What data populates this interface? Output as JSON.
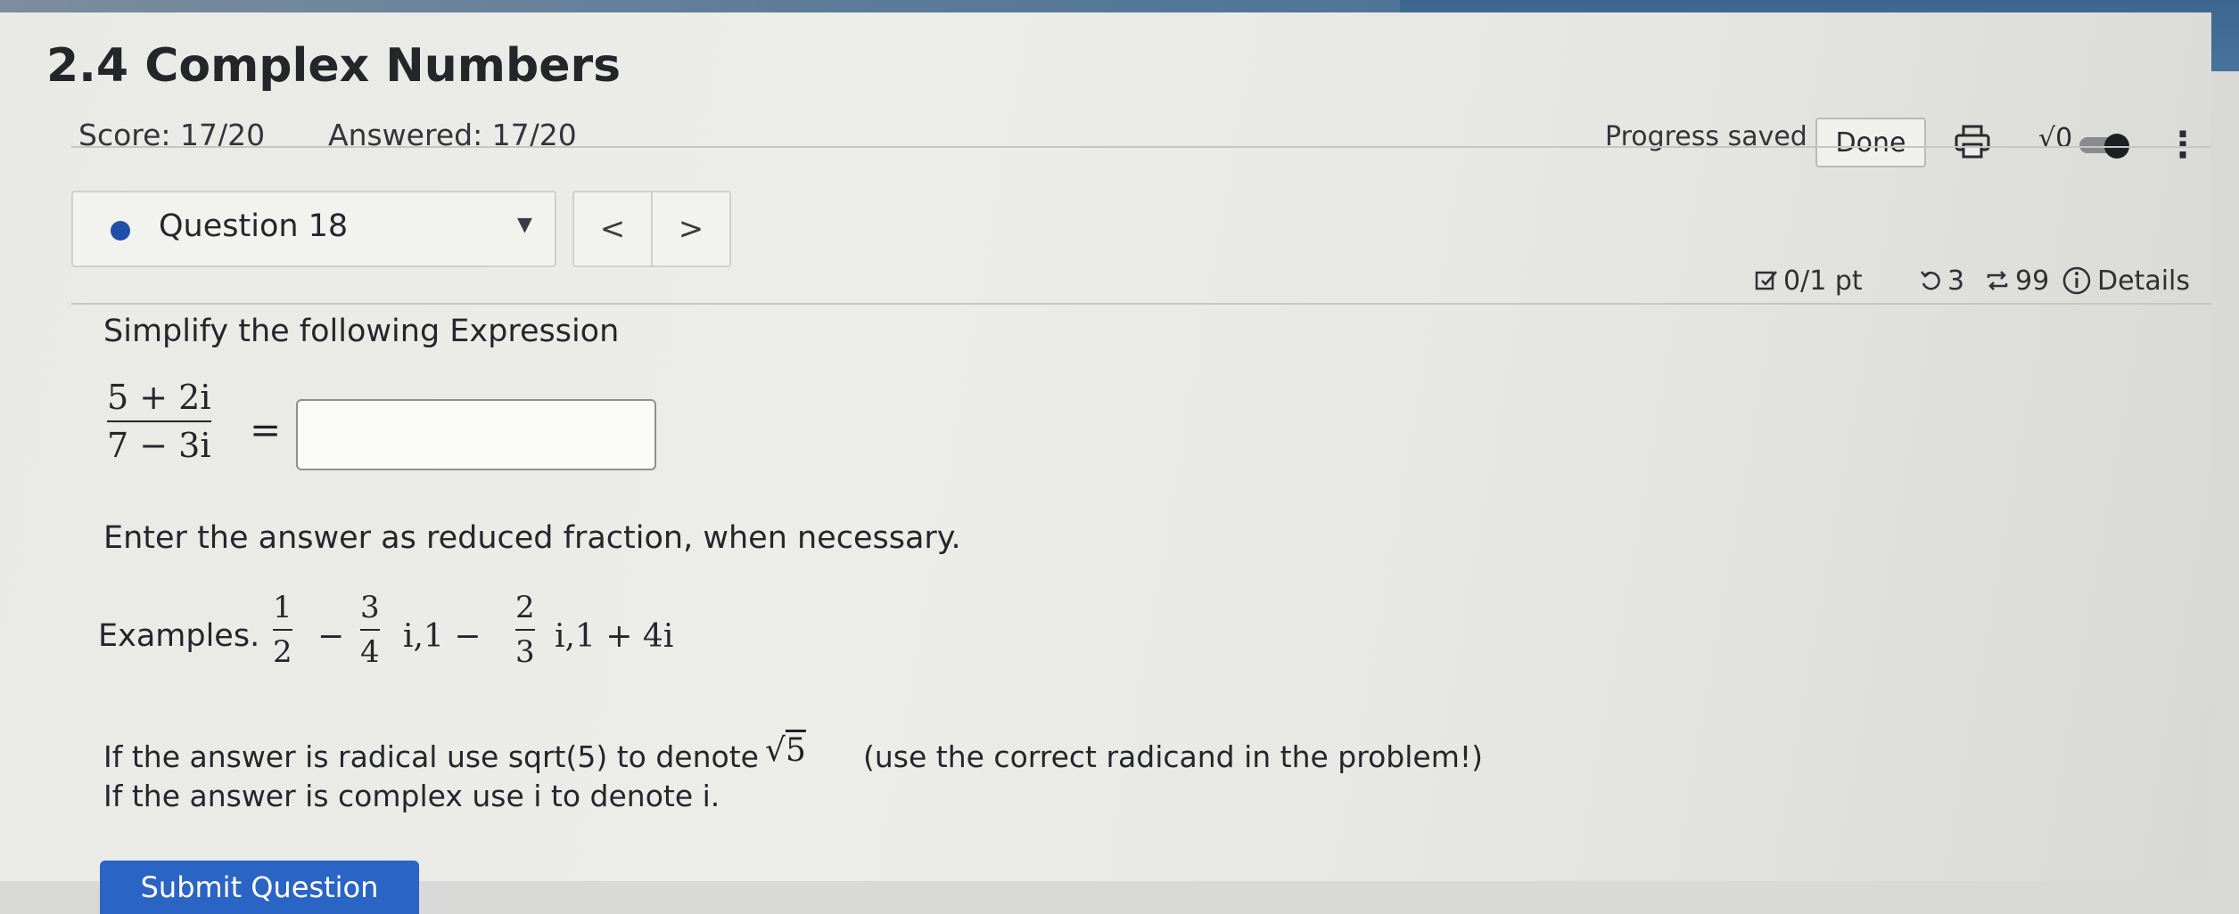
{
  "header": {
    "title": "2.4 Complex Numbers",
    "score": "Score: 17/20",
    "answered": "Answered: 17/20",
    "progress_status": "Progress saved",
    "done_label": "Done",
    "sqrt_toggle_label": "√0",
    "more_icon": "more-vertical-icon",
    "print_icon": "print-icon"
  },
  "question_nav": {
    "selected_question": "Question 18",
    "prev_label": "<",
    "next_label": ">"
  },
  "question_meta": {
    "points": "0/1 pt",
    "retries": "3",
    "submissions": "99",
    "details_label": "Details"
  },
  "problem": {
    "prompt": "Simplify the following Expression",
    "numerator": "5 + 2i",
    "denominator": "7 − 3i",
    "equals": "=",
    "answer_value": "",
    "instruction": "Enter the answer as reduced fraction, when necessary.",
    "examples_label": "Examples.",
    "example_1_num": "1",
    "example_1_den": "2",
    "example_minus": "−",
    "example_2_num": "3",
    "example_2_den": "4",
    "example_sep_1": "i,1 −",
    "example_3_num": "2",
    "example_3_den": "3",
    "example_tail": "i,1 + 4i",
    "radical_text": "If the answer is radical use sqrt(5) to denote",
    "sqrt_symbol": "√",
    "sqrt_radicand": "5",
    "radical_tail": "(use the correct radicand in the problem!)",
    "complex_text": "If the answer is complex use i to denote i."
  },
  "footer": {
    "submit_label": "Submit Question"
  },
  "colors": {
    "accent_blue": "#2a64c4",
    "status_dot": "#1f4fa8"
  }
}
